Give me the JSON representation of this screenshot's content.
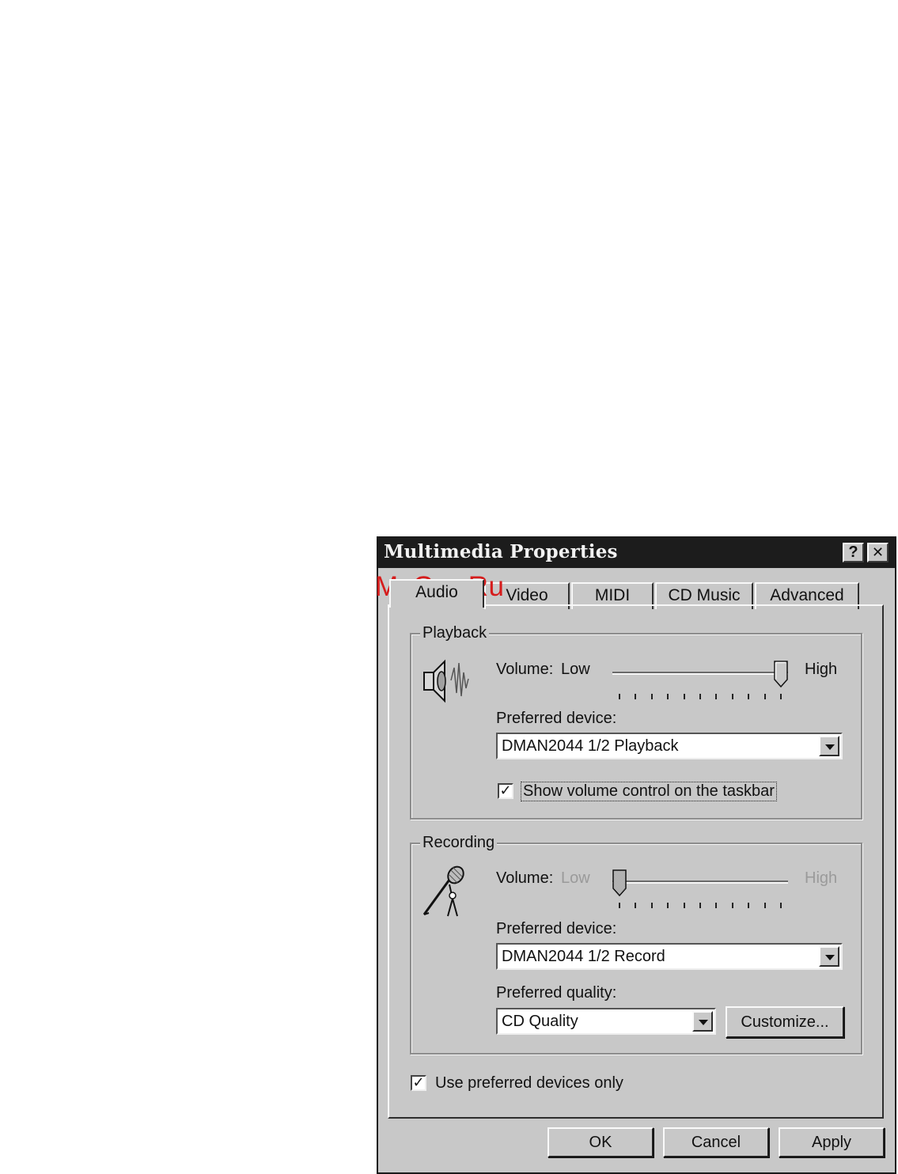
{
  "window": {
    "title": "Multimedia Properties",
    "help_glyph": "?",
    "close_glyph": "✕"
  },
  "tabs": [
    "Audio",
    "Video",
    "MIDI",
    "CD Music",
    "Advanced"
  ],
  "watermark": "McGrp.Ru",
  "playback": {
    "group_label": "Playback",
    "volume_label": "Volume:",
    "low_label": "Low",
    "high_label": "High",
    "volume_level": 1.0,
    "device_label": "Preferred device:",
    "device_value": "DMAN2044 1/2 Playback",
    "taskbar_label": "Show volume control on the taskbar",
    "taskbar_checked": true
  },
  "recording": {
    "group_label": "Recording",
    "volume_label": "Volume:",
    "low_label": "Low",
    "high_label": "High",
    "volume_level": 0.0,
    "device_label": "Preferred device:",
    "device_value": "DMAN2044 1/2 Record",
    "quality_label": "Preferred quality:",
    "quality_value": "CD Quality",
    "customize_label": "Customize..."
  },
  "use_preferred": {
    "label": "Use preferred devices only",
    "checked": true
  },
  "buttons": {
    "ok": "OK",
    "cancel": "Cancel",
    "apply": "Apply"
  },
  "icons": {
    "playback": "speaker-icon",
    "recording": "microphone-icon",
    "dropdown": "chevron-down-icon"
  }
}
